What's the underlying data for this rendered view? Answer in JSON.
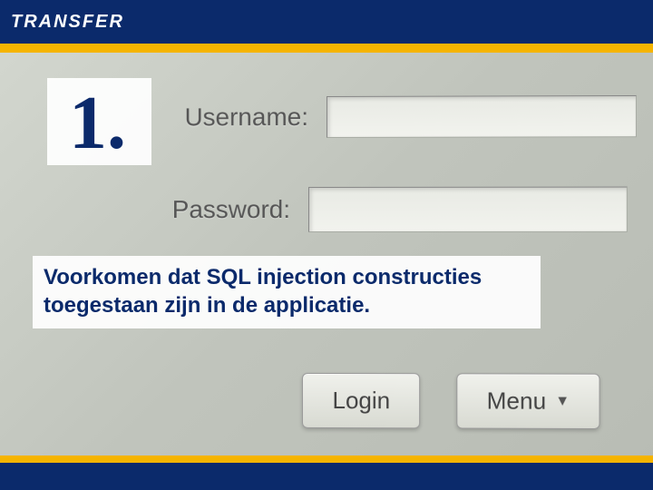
{
  "header": {
    "logo_text": "TRANSFER"
  },
  "slide": {
    "number": "1.",
    "caption": "Voorkomen dat SQL injection constructies toegestaan zijn in de applicatie."
  },
  "form": {
    "username_label": "Username:",
    "password_label": "Password:",
    "login_button": "Login",
    "menu_button": "Menu",
    "menu_arrow": "▼"
  }
}
